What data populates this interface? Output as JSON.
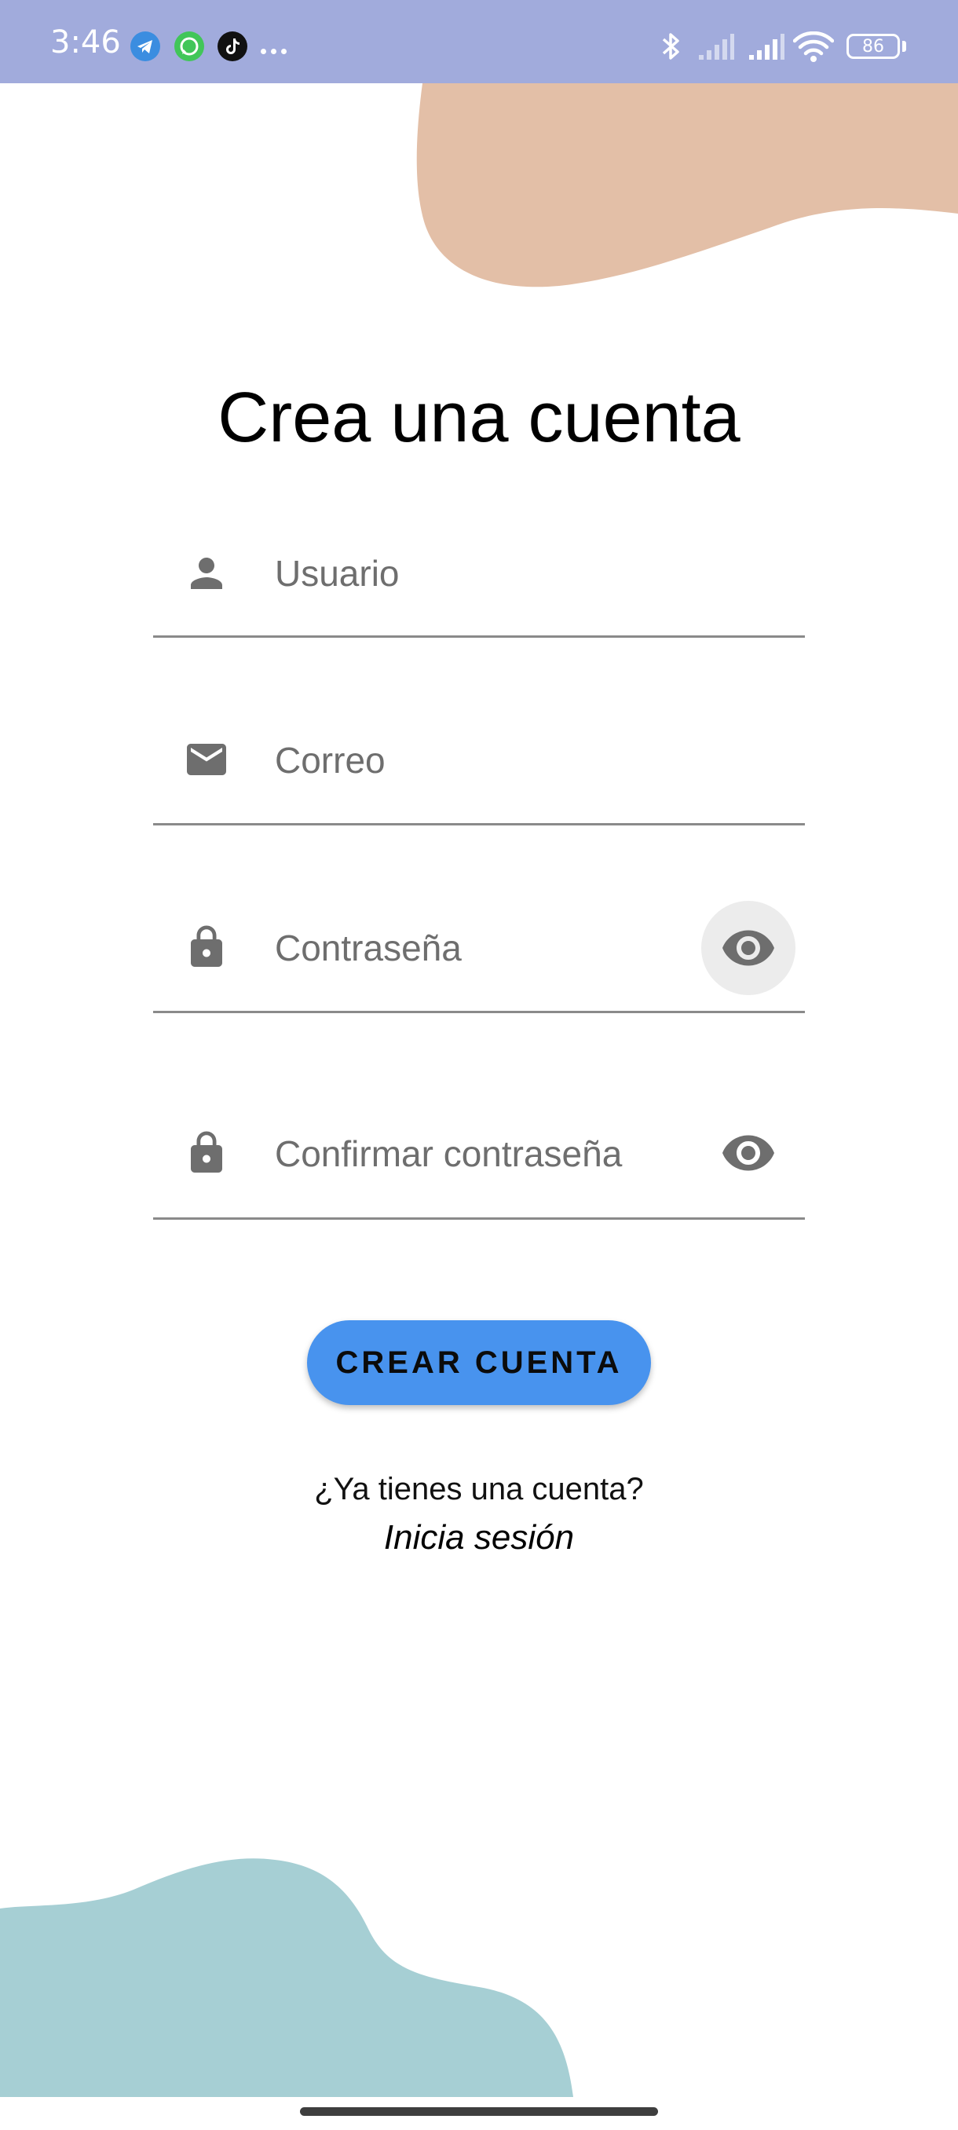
{
  "status_bar": {
    "time": "3:46",
    "battery_level": "86",
    "notification_icons": [
      "telegram-icon",
      "whatsapp-icon",
      "tiktok-icon",
      "more-notifications-icon"
    ],
    "system_icons": [
      "bluetooth-icon",
      "signal-1-icon",
      "signal-2-icon",
      "wifi-icon",
      "battery-icon"
    ],
    "background_color": "#a1abdc"
  },
  "colors": {
    "top_blob": "#e3bfa7",
    "bottom_blob": "#a6cfd4",
    "accent_button": "#4893ee",
    "icon_gray": "#6e6e6e"
  },
  "title": "Crea una cuenta",
  "form": {
    "username_placeholder": "Usuario",
    "email_placeholder": "Correo",
    "password_placeholder": "Contraseña",
    "confirm_password_placeholder": "Confirmar contraseña"
  },
  "submit_label": "CREAR CUENTA",
  "footer": {
    "prompt": "¿Ya tienes una cuenta?",
    "login_link": "Inicia sesión"
  }
}
